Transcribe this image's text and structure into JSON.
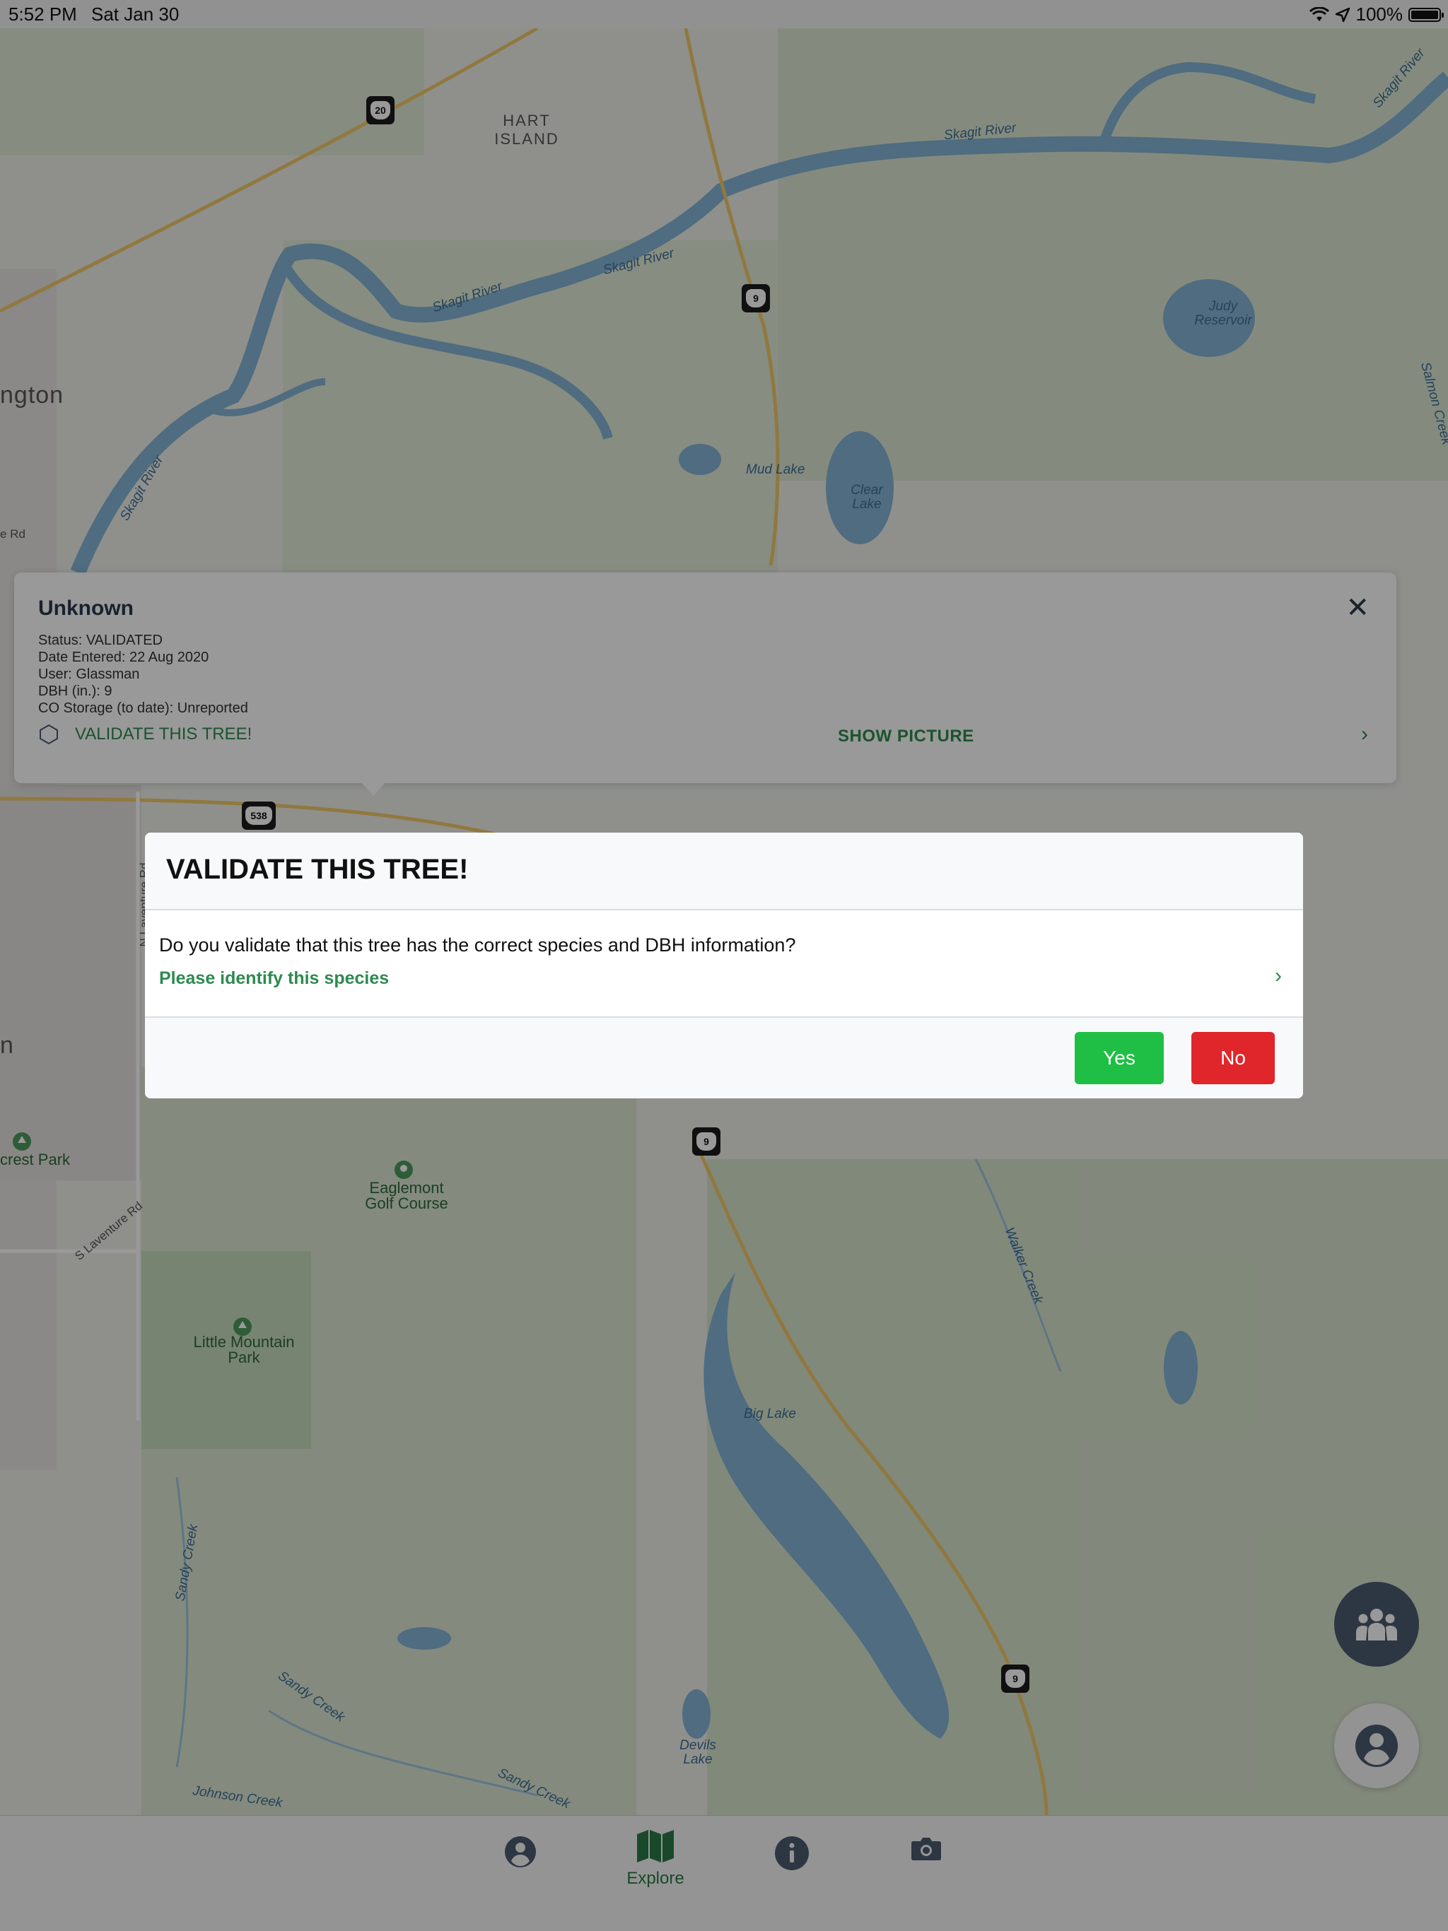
{
  "status_bar": {
    "time": "5:52 PM",
    "date": "Sat Jan 30",
    "battery": "100%",
    "icons": [
      "wifi-icon",
      "location-arrow-icon",
      "battery-icon"
    ]
  },
  "map": {
    "water_labels": [
      "Skagit River",
      "Skagit River",
      "Skagit River",
      "Skagit River",
      "Skagit River",
      "Judy Reservoir",
      "Mud Lake",
      "Clear Lake",
      "Big Lake",
      "Devils Lake",
      "Sandy Creek",
      "Sandy Creek",
      "Sandy Creek",
      "Johnson Creek",
      "Walker Creek",
      "Salmon Creek"
    ],
    "place_labels": [
      "HART ISLAND",
      "ngton",
      "n"
    ],
    "park_labels": [
      "Eaglemont Golf Course",
      "Little Mountain Park",
      "crest Park"
    ],
    "road_labels": [
      "N Laventure Rd",
      "S Laventure Rd",
      "e Rd"
    ],
    "highway_shields": [
      "20",
      "9",
      "538",
      "9",
      "9"
    ]
  },
  "info_card": {
    "title": "Unknown",
    "status": "Status: VALIDATED",
    "date_entered": "Date Entered: 22 Aug 2020",
    "user": "User: Glassman",
    "dbh": "DBH (in.): 9",
    "co_storage": "CO Storage (to date): Unreported",
    "validate_label": "VALIDATE THIS TREE!",
    "show_picture_label": "SHOW PICTURE"
  },
  "modal": {
    "title": "VALIDATE THIS TREE!",
    "question": "Do you validate that this tree has the correct species and DBH information?",
    "identify_link": "Please identify this species",
    "yes_label": "Yes",
    "no_label": "No"
  },
  "tab_bar": {
    "tabs": [
      {
        "icon": "user-circle-icon",
        "label": ""
      },
      {
        "icon": "map-icon",
        "label": "Explore"
      },
      {
        "icon": "info-circle-icon",
        "label": ""
      },
      {
        "icon": "camera-icon",
        "label": ""
      }
    ],
    "active_color": "#2a7a47"
  },
  "colors": {
    "accent_green": "#2e8a4f",
    "yes_button": "#1fbf45",
    "no_button": "#e0252b",
    "card_title": "#2b3a4e"
  }
}
